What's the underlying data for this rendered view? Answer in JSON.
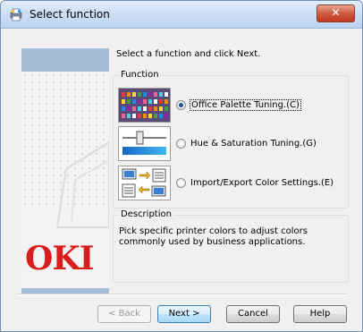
{
  "window": {
    "title": "Select function",
    "close_glyph": "✕"
  },
  "sidebar": {
    "logo_text": "OKI",
    "logo_color": "#d81c1c",
    "band_color": "#a7bdd8"
  },
  "instruction": "Select a function and click Next.",
  "function_group": {
    "title": "Function",
    "options": [
      {
        "icon": "palette-icon",
        "label": "Office Palette Tuning.(C)",
        "selected": true
      },
      {
        "icon": "slider-icon",
        "label": "Hue & Saturation Tuning.(G)",
        "selected": false
      },
      {
        "icon": "import-export-icon",
        "label": "Import/Export Color Settings.(E)",
        "selected": false
      }
    ]
  },
  "description": {
    "title": "Description",
    "text": "Pick specific printer colors to adjust colors commonly used by business applications."
  },
  "buttons": {
    "back": "< Back",
    "next": "Next >",
    "cancel": "Cancel",
    "help": "Help"
  }
}
